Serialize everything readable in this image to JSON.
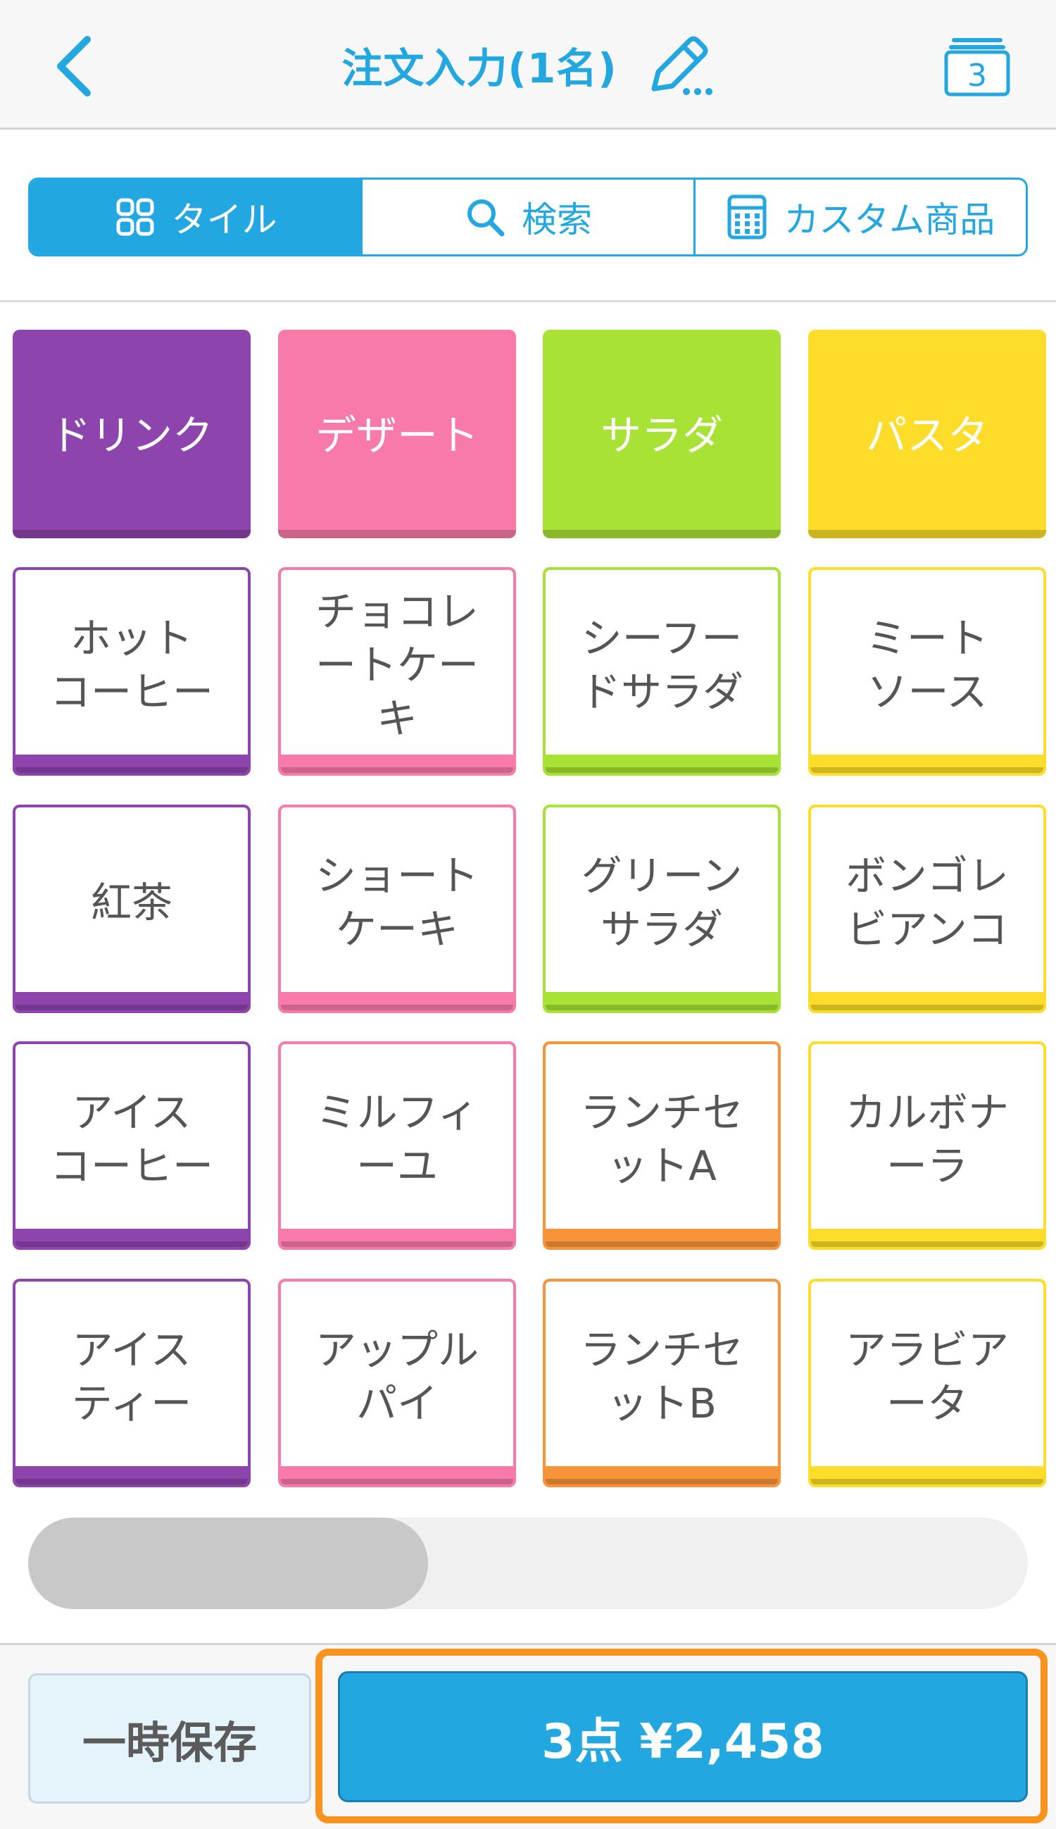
{
  "header": {
    "title": "注文入力(1名)",
    "badge_count": "3"
  },
  "segments": [
    {
      "label": "タイル",
      "icon": "grid-icon",
      "active": true
    },
    {
      "label": "検索",
      "icon": "search-icon",
      "active": false
    },
    {
      "label": "カスタム商品",
      "icon": "calculator-icon",
      "active": false
    }
  ],
  "categories": [
    {
      "label": "ドリンク",
      "color": "#8e44ad"
    },
    {
      "label": "デザート",
      "color": "#f77aaa"
    },
    {
      "label": "サラダ",
      "color": "#a8e234"
    },
    {
      "label": "パスタ",
      "color": "#fddc2a"
    }
  ],
  "item_rows": [
    [
      {
        "label": "ホット\nコーヒー",
        "color": "#8e44ad"
      },
      {
        "label": "チョコレ\nートケー\nキ",
        "color": "#f77aaa"
      },
      {
        "label": "シーフー\nドサラダ",
        "color": "#a8e234"
      },
      {
        "label": "ミート\nソース",
        "color": "#fddc2a"
      }
    ],
    [
      {
        "label": "紅茶",
        "color": "#8e44ad"
      },
      {
        "label": "ショート\nケーキ",
        "color": "#f77aaa"
      },
      {
        "label": "グリーン\nサラダ",
        "color": "#a8e234"
      },
      {
        "label": "ボンゴレ\nビアンコ",
        "color": "#fddc2a"
      }
    ],
    [
      {
        "label": "アイス\nコーヒー",
        "color": "#8e44ad"
      },
      {
        "label": "ミルフィ\nーユ",
        "color": "#f77aaa"
      },
      {
        "label": "ランチセ\nットA",
        "color": "#f7943a"
      },
      {
        "label": "カルボナ\nーラ",
        "color": "#fddc2a"
      }
    ],
    [
      {
        "label": "アイス\nティー",
        "color": "#8e44ad"
      },
      {
        "label": "アップル\nパイ",
        "color": "#f77aaa"
      },
      {
        "label": "ランチセ\nットB",
        "color": "#f7943a"
      },
      {
        "label": "アラビア\nータ",
        "color": "#fddc2a"
      }
    ]
  ],
  "scroll_position": 0.4,
  "footer": {
    "save_label": "一時保存",
    "checkout_label": "3点 ¥2,458"
  },
  "colors": {
    "accent": "#22a7e0",
    "highlight": "#f7931e"
  }
}
